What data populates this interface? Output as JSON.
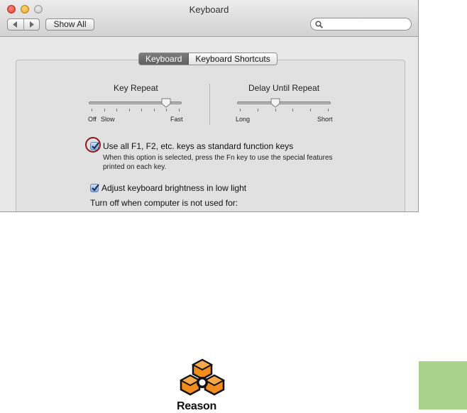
{
  "window": {
    "title": "Keyboard",
    "show_all_label": "Show All",
    "search_placeholder": ""
  },
  "tabs": [
    {
      "label": "Keyboard",
      "active": true
    },
    {
      "label": "Keyboard Shortcuts",
      "active": false
    }
  ],
  "key_repeat": {
    "title": "Key Repeat",
    "label_off": "Off",
    "label_slow": "Slow",
    "label_fast": "Fast",
    "level": 0.87
  },
  "delay_until_repeat": {
    "title": "Delay Until Repeat",
    "label_long": "Long",
    "label_short": "Short",
    "level": 0.4
  },
  "options": {
    "function_keys": {
      "checked": true,
      "label": "Use all F1, F2, etc. keys as standard function keys",
      "description": "When this option is selected, press the Fn key to use the special features printed on each key."
    },
    "brightness": {
      "checked": true,
      "label": "Adjust keyboard brightness in low light"
    },
    "turn_off_label": "Turn off when computer is not used for:"
  },
  "logo": {
    "text": "Reason",
    "colors": {
      "primary": "#f28c1e",
      "secondary": "#111111"
    }
  },
  "colors": {
    "highlight_circle": "#8b1a1a",
    "green_block": "#a9d18e"
  }
}
